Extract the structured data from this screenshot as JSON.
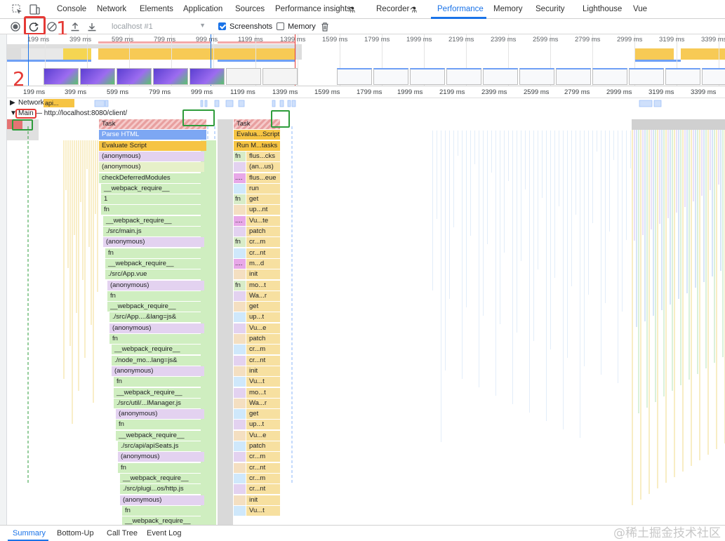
{
  "tabs": [
    "Console",
    "Network",
    "Elements",
    "Application",
    "Sources",
    "Performance insights",
    "Recorder",
    "Performance",
    "Memory",
    "Security",
    "Lighthouse",
    "Vue"
  ],
  "active_tab": "Performance",
  "toolbar": {
    "target": "localhost #1",
    "screenshots_label": "Screenshots",
    "screenshots_checked": true,
    "memory_label": "Memory",
    "memory_checked": false
  },
  "annotations": {
    "one": "1",
    "two": "2"
  },
  "overview_ticks": [
    "199 ms",
    "399 ms",
    "599 ms",
    "799 ms",
    "999 ms",
    "1199 ms",
    "1399 ms",
    "1599 ms",
    "1799 ms",
    "1999 ms",
    "2199 ms",
    "2399 ms",
    "2599 ms",
    "2799 ms",
    "2999 ms",
    "3199 ms",
    "3399 ms"
  ],
  "ruler_ticks": [
    "199 ms",
    "399 ms",
    "599 ms",
    "799 ms",
    "999 ms",
    "1199 ms",
    "1399 ms",
    "1599 ms",
    "1799 ms",
    "1999 ms",
    "2199 ms",
    "2399 ms",
    "2599 ms",
    "2799 ms",
    "2999 ms",
    "3199 ms",
    "3399 ms"
  ],
  "tracks": {
    "network_label": "Network",
    "network_item": "api...",
    "main_label": "Main",
    "main_url": "— http://localhost:8080/client/"
  },
  "flame_left": [
    "Task",
    "Parse HTML",
    "Evaluate Script",
    "(anonymous)",
    "(anonymous)",
    "checkDeferredModules",
    "__webpack_require__",
    "1",
    "fn",
    "__webpack_require__",
    "./src/main.js",
    "(anonymous)",
    "fn",
    "__webpack_require__",
    "./src/App.vue",
    "(anonymous)",
    "fn",
    "__webpack_require__",
    "./src/App....&lang=js&",
    "(anonymous)",
    "fn",
    "__webpack_require__",
    "./node_mo...lang=js&",
    "(anonymous)",
    "fn",
    "__webpack_require__",
    "./src/util/...lManager.js",
    "(anonymous)",
    "fn",
    "__webpack_require__",
    "./src/api/apiSeats.js",
    "(anonymous)",
    "fn",
    "__webpack_require__",
    "./src/plugi...os/http.js",
    "(anonymous)",
    "fn",
    "__webpack_require__"
  ],
  "flame_right": [
    "Task",
    "Evalua...Script",
    "Run M...tasks",
    "flus...cks",
    "(an...us)",
    "flus...eue",
    "run",
    "get",
    "up...nt",
    "Vu...te",
    "patch",
    "cr...m",
    "cr...nt",
    "m...d",
    "init",
    "mo...t",
    "Wa...r",
    "get",
    "up...t",
    "Vu...e",
    "patch",
    "cr...m",
    "cr...nt",
    "init",
    "Vu...t",
    "mo...t",
    "Wa...r",
    "get",
    "up...t",
    "Vu...e",
    "patch",
    "cr...m",
    "cr...nt",
    "cr...m",
    "cr...nt",
    "init",
    "Vu...t"
  ],
  "flame_right_fn": [
    "",
    "",
    "",
    "fn",
    "",
    "....",
    "",
    "fn",
    "",
    "....",
    "",
    "fn",
    "",
    "....",
    "",
    "fn",
    "",
    "",
    "",
    "",
    "",
    "",
    "",
    "",
    "",
    "",
    "",
    "",
    "",
    "",
    "",
    "",
    "",
    "",
    "",
    "",
    ""
  ],
  "bottom_tabs": [
    "Summary",
    "Bottom-Up",
    "Call Tree",
    "Event Log"
  ],
  "active_bottom_tab": "Summary",
  "watermark": "@稀土掘金技术社区",
  "colors": {
    "accent": "#1a73e8",
    "task": "#f0c7c7",
    "script": "#f6c443",
    "parse": "#7da7f3",
    "green": "#cfeec0",
    "annotation": "#e53935"
  }
}
